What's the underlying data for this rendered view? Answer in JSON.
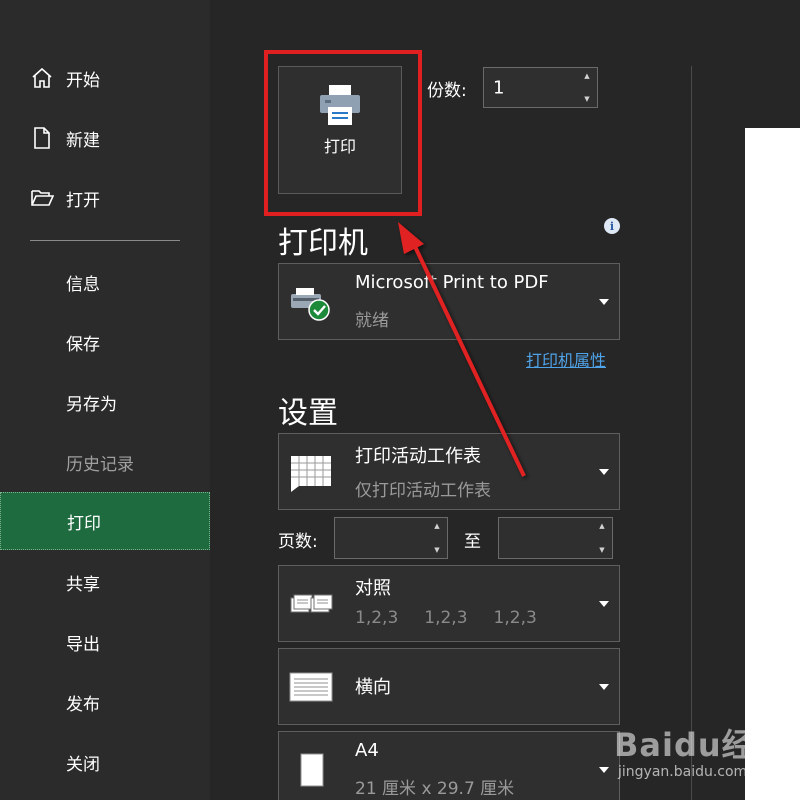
{
  "sidebar": {
    "items": [
      {
        "label": "开始",
        "icon": "home-icon",
        "state": "normal"
      },
      {
        "label": "新建",
        "icon": "new-document-icon",
        "state": "normal"
      },
      {
        "label": "打开",
        "icon": "folder-open-icon",
        "state": "normal"
      },
      {
        "label": "信息",
        "state": "normal"
      },
      {
        "label": "保存",
        "state": "normal"
      },
      {
        "label": "另存为",
        "state": "normal"
      },
      {
        "label": "历史记录",
        "state": "disabled"
      },
      {
        "label": "打印",
        "state": "active"
      },
      {
        "label": "共享",
        "state": "normal"
      },
      {
        "label": "导出",
        "state": "normal"
      },
      {
        "label": "发布",
        "state": "normal"
      },
      {
        "label": "关闭",
        "state": "normal"
      }
    ]
  },
  "print": {
    "button_label": "打印",
    "button_icon": "printer-icon",
    "copies_label": "份数:",
    "copies_value": "1"
  },
  "printer": {
    "heading": "打印机",
    "name": "Microsoft Print to PDF",
    "status": "就绪",
    "icon": "printer-ready-icon",
    "properties_link": "打印机属性"
  },
  "settings": {
    "heading": "设置",
    "scope": {
      "title": "打印活动工作表",
      "subtitle": "仅打印活动工作表",
      "icon": "worksheet-grid-icon"
    },
    "pages_label": "页数:",
    "pages_from": "",
    "to_label": "至",
    "pages_to": "",
    "collate": {
      "title": "对照",
      "values": [
        "1,2,3",
        "1,2,3",
        "1,2,3"
      ],
      "icon": "collated-pages-icon"
    },
    "orientation": {
      "title": "横向",
      "icon": "landscape-page-icon"
    },
    "paper": {
      "title": "A4",
      "subtitle": "21 厘米 x 29.7 厘米",
      "icon": "paper-size-icon"
    }
  },
  "watermark": {
    "brand": "Baidu经验",
    "url": "jingyan.baidu.com"
  },
  "colors": {
    "highlight": "#e02020",
    "active_nav": "#1e6b3f",
    "link": "#4fa3e8"
  }
}
